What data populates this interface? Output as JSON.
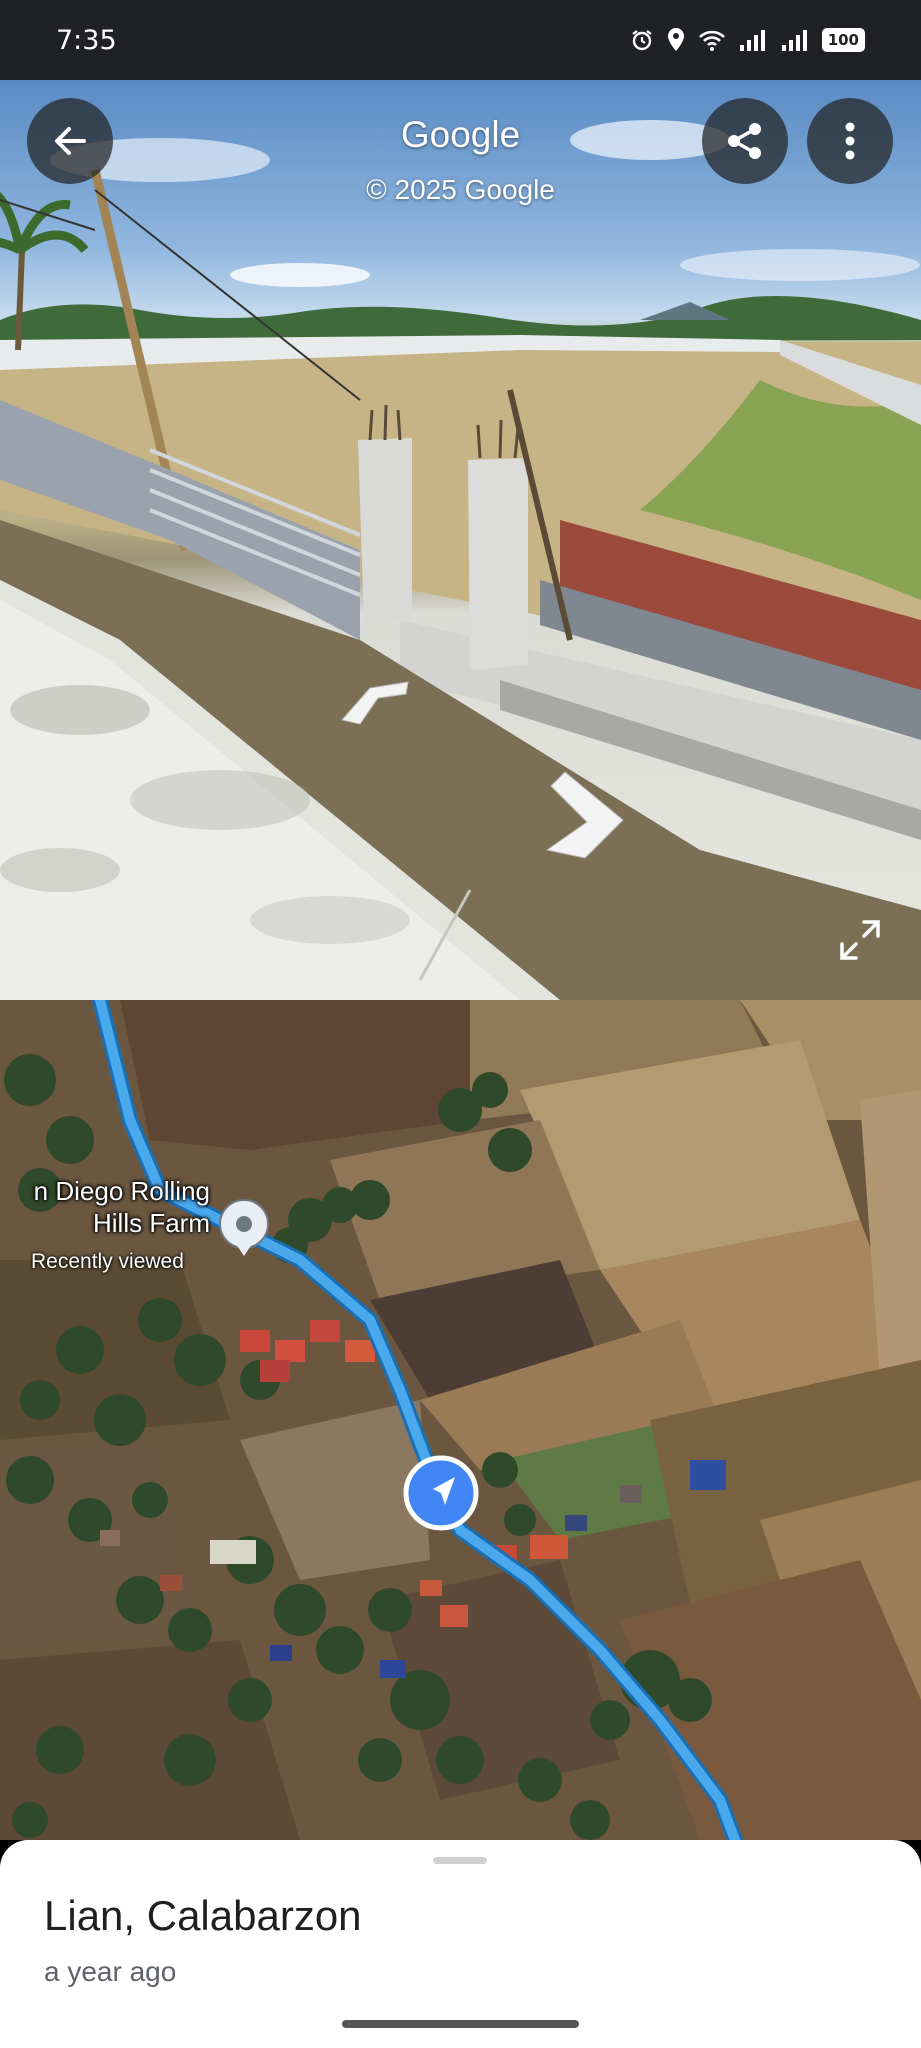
{
  "status_bar": {
    "time": "7:35",
    "battery": "100",
    "icons": [
      "alarm-icon",
      "location-icon",
      "wifi-icon",
      "signal-icon",
      "signal-icon",
      "battery-icon"
    ]
  },
  "street_view": {
    "title": "Google",
    "copyright": "© 2025 Google",
    "buttons": [
      "back-arrow-icon",
      "share-icon",
      "more-vert-icon",
      "fullscreen-icon"
    ]
  },
  "map": {
    "place_name": "n Diego Rolling Hills Farm",
    "place_status": "Recently viewed",
    "route_color": "#4aa8ec",
    "accent": "#4285f4"
  },
  "sheet": {
    "title": "Lian, Calabarzon",
    "subtitle": "a year ago"
  }
}
